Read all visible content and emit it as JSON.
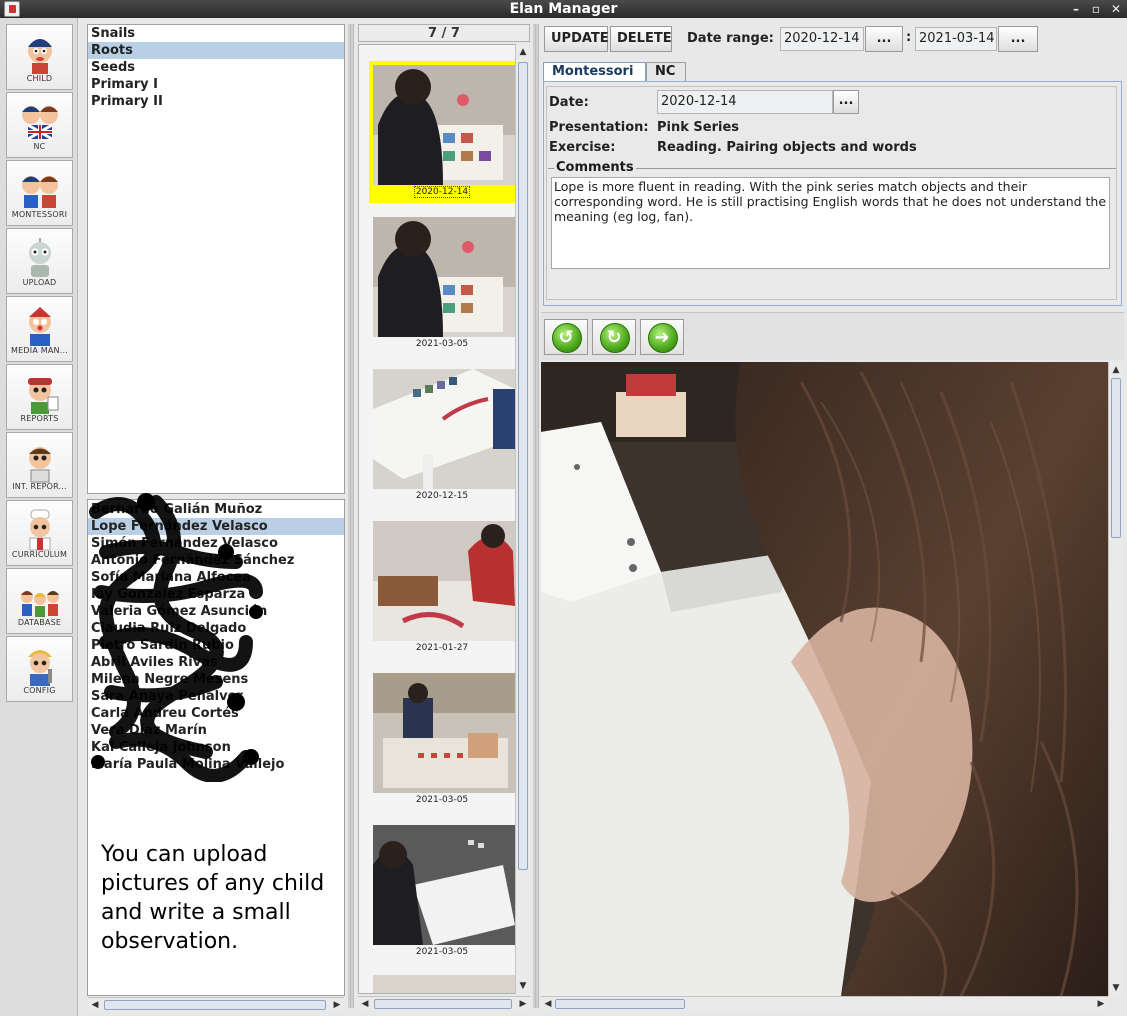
{
  "window": {
    "title": "Elan Manager",
    "controls": [
      "–",
      "▫",
      "✕"
    ]
  },
  "sidebar": {
    "items": [
      {
        "label": "CHILD",
        "icon": "child-icon"
      },
      {
        "label": "NC",
        "icon": "nc-icon"
      },
      {
        "label": "MONTESSORI",
        "icon": "montessori-icon"
      },
      {
        "label": "UPLOAD",
        "icon": "upload-icon"
      },
      {
        "label": "MEDIA MAN...",
        "icon": "media-manager-icon"
      },
      {
        "label": "REPORTS",
        "icon": "reports-icon"
      },
      {
        "label": "INT. REPOR...",
        "icon": "internal-reports-icon"
      },
      {
        "label": "CURRICULUM",
        "icon": "curriculum-icon"
      },
      {
        "label": "DATABASE",
        "icon": "database-icon"
      },
      {
        "label": "CONFIG",
        "icon": "config-icon"
      }
    ]
  },
  "groups": {
    "items": [
      "Snails",
      "Roots",
      "Seeds",
      "Primary I",
      "Primary II"
    ],
    "selected": "Roots"
  },
  "children": {
    "items": [
      "Bernardo Galián Muñoz",
      "Lope Fernández Velasco",
      "Simón Fernández Velasco",
      "Antonio Fernández Sánchez",
      "Sofía Mariana Alfocea",
      "Iay Gonzalez Esparza",
      "Valeria Gómez Asunción",
      "Claudia Ruiz Delgado",
      "Pietro Sardin Rubio",
      "Abril Aviles Rivas",
      "Milena Negre Mesens",
      "Sara Anaya Peñalver",
      "Carla Andreu Cortés",
      "Vera Díaz Marín",
      "Kai Calleja Johnson",
      "María Paula Molina Vallejo"
    ],
    "selected_index": 1
  },
  "note": "You can upload pictures of any child and write a small observation.",
  "thumbnails": {
    "counter": "7 / 7",
    "items": [
      {
        "date": "2020-12-14",
        "selected": true
      },
      {
        "date": "2021-03-05",
        "selected": false
      },
      {
        "date": "2020-12-15",
        "selected": false
      },
      {
        "date": "2021-01-27",
        "selected": false
      },
      {
        "date": "2021-03-05",
        "selected": false
      },
      {
        "date": "2021-03-05",
        "selected": false
      }
    ]
  },
  "toolbar": {
    "update_label": "UPDATE",
    "delete_label": "DELETE",
    "date_range_label": "Date range:",
    "date_from": "2020-12-14",
    "date_to": "2021-03-14",
    "picker_label": "...",
    "separator": ":"
  },
  "tabs": [
    {
      "label": "Montessori",
      "active": true
    },
    {
      "label": "NC",
      "active": false
    }
  ],
  "form": {
    "date_label": "Date:",
    "date_value": "2020-12-14",
    "presentation_label": "Presentation:",
    "presentation_value": "Pink Series",
    "exercise_label": "Exercise:",
    "exercise_value": "Reading. Pairing objects and words",
    "comments_legend": "Comments",
    "comments_text": "Lope is more fluent in reading. With the pink series match objects and their corresponding word. He is still practising English words that he does not understand the meaning (eg log, fan)."
  },
  "nav": {
    "rotate_left": "↺",
    "rotate_right": "↻",
    "next": "➜"
  },
  "colors": {
    "selection": "#b8cfe5",
    "thumb_highlight": "#ffff00",
    "nav_green": "#4aa81c"
  }
}
